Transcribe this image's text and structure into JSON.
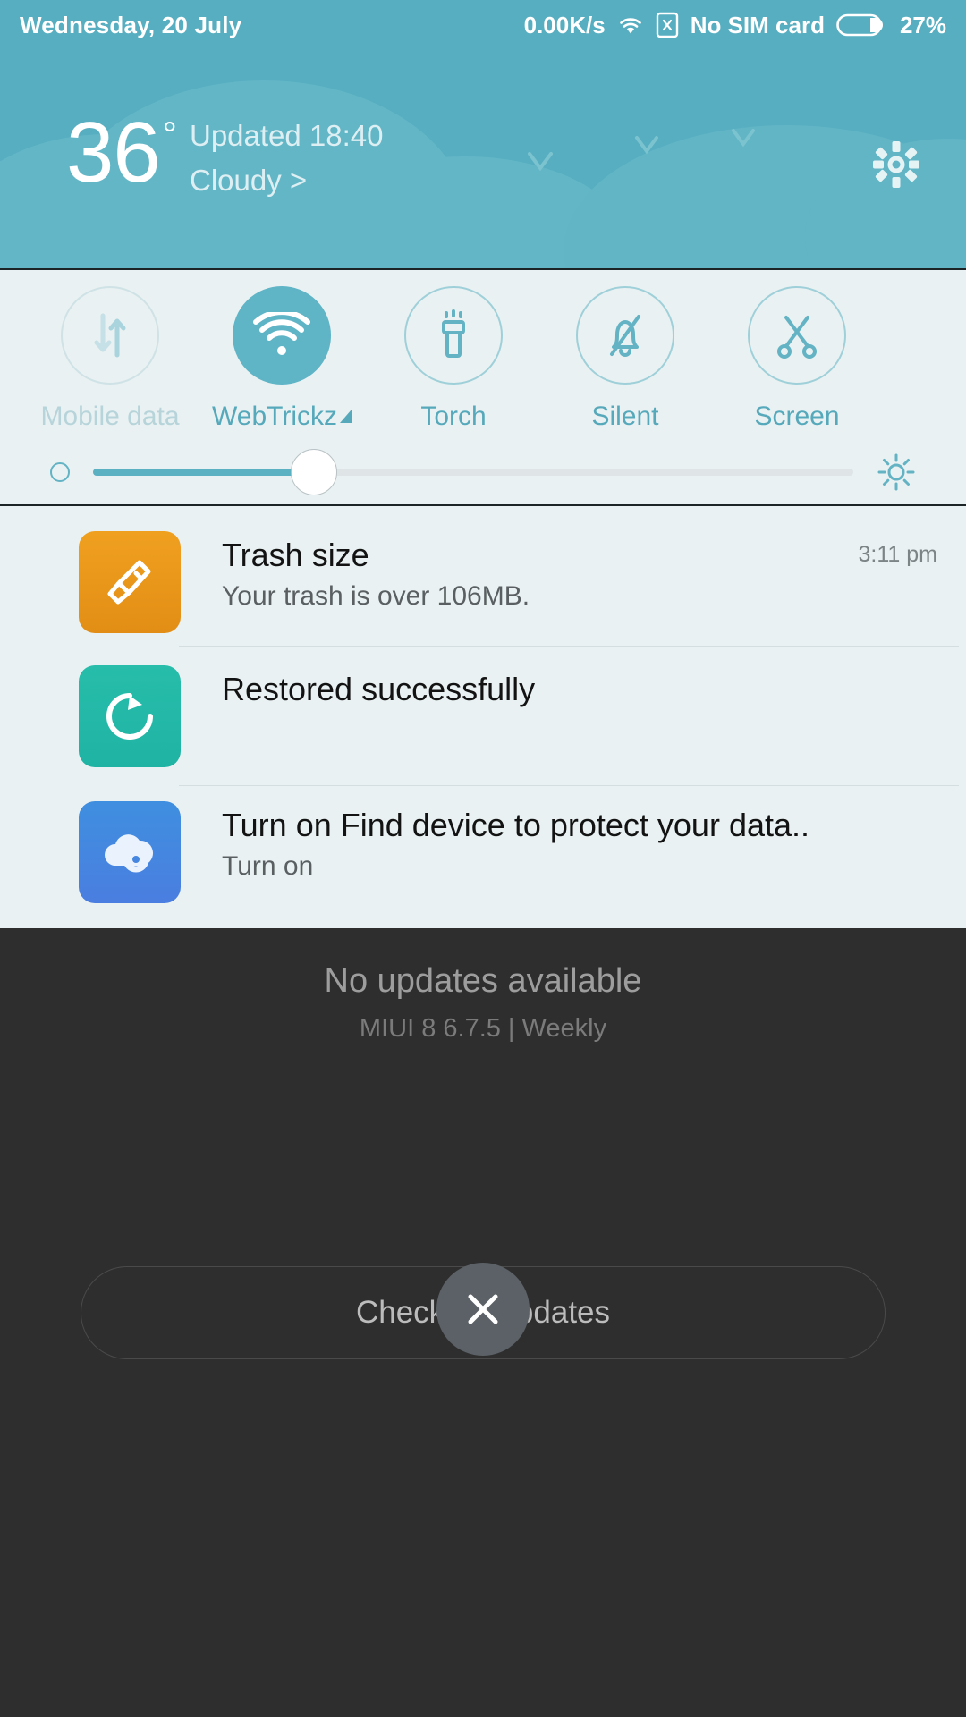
{
  "statusbar": {
    "date": "Wednesday, 20 July",
    "network_speed": "0.00K/s",
    "sim_text": "No SIM card",
    "battery_percent": "27%",
    "wifi_icon": "wifi-icon",
    "sim_icon": "sim-card-x-icon",
    "battery_icon": "battery-icon"
  },
  "weather": {
    "temperature": "36",
    "degree_symbol": "°",
    "updated": "Updated 18:40",
    "condition": "Cloudy >",
    "settings_icon": "gear-icon",
    "accent_color": "#57aec0"
  },
  "quick_settings": {
    "toggles": [
      {
        "label": "Mobile data",
        "icon": "mobile-data-icon",
        "state": "off",
        "dim": true
      },
      {
        "label": "WebTrickz",
        "icon": "wifi-icon",
        "state": "on",
        "dim": false,
        "has_expand_triangle": true
      },
      {
        "label": "Torch",
        "icon": "torch-icon",
        "state": "off",
        "dim": false
      },
      {
        "label": "Silent",
        "icon": "silent-bell-icon",
        "state": "off",
        "dim": false
      },
      {
        "label": "Screen",
        "icon": "screenshot-icon",
        "state": "off",
        "dim": false
      }
    ],
    "brightness": {
      "value_percent": 29,
      "low_icon": "brightness-low-icon",
      "high_icon": "brightness-high-icon"
    },
    "active_color": "#5fb4c6",
    "panel_background": "#e9f1f2"
  },
  "notifications": [
    {
      "icon": "cleaner-brush-icon",
      "icon_color": "#e99417",
      "title": "Trash size",
      "subtitle": "Your trash is over 106MB.",
      "time": "3:11 pm"
    },
    {
      "icon": "restore-refresh-icon",
      "icon_color": "#22b8a8",
      "title": "Restored successfully",
      "subtitle": "",
      "time": ""
    },
    {
      "icon": "mi-cloud-icon",
      "icon_color": "#4486e0",
      "title": "Turn on Find device to protect your data..",
      "subtitle": "Turn on",
      "time": ""
    }
  ],
  "updater": {
    "status_title": "No updates available",
    "version_info": "MIUI 8 6.7.5 | Weekly",
    "check_button": "Check for updates",
    "close_icon": "close-icon"
  }
}
